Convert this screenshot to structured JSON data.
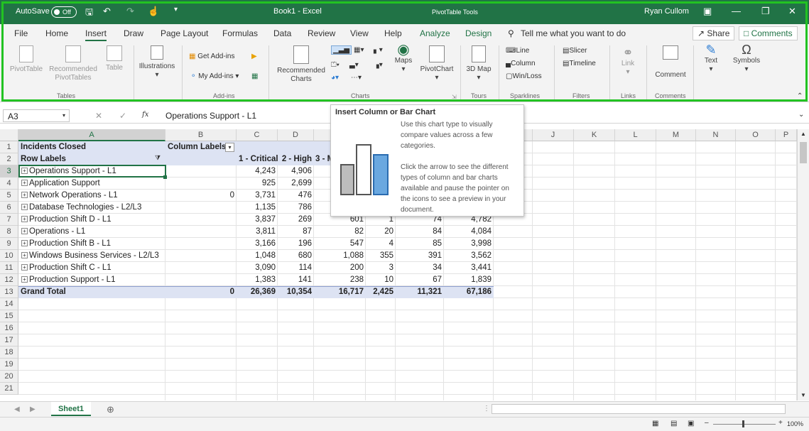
{
  "titlebar": {
    "autosave": "AutoSave",
    "toggle": "Off",
    "doc": "Book1 - Excel",
    "context": "PivotTable Tools",
    "user": "Ryan Cullom"
  },
  "tabs": [
    "File",
    "Home",
    "Insert",
    "Draw",
    "Page Layout",
    "Formulas",
    "Data",
    "Review",
    "View",
    "Help",
    "Analyze",
    "Design"
  ],
  "tellme": "Tell me what you want to do",
  "share": "Share",
  "comments": "Comments",
  "ribbon": {
    "pivottable": "PivotTable",
    "recommended_pt": "Recommended PivotTables",
    "table": "Table",
    "illustrations": "Illustrations",
    "get_addins": "Get Add-ins",
    "my_addins": "My Add-ins",
    "rec_charts": "Recommended Charts",
    "maps": "Maps",
    "pivotchart": "PivotChart",
    "map3d": "3D Map",
    "line": "Line",
    "column": "Column",
    "winloss": "Win/Loss",
    "slicer": "Slicer",
    "timeline": "Timeline",
    "link": "Link",
    "comment": "Comment",
    "text": "Text",
    "symbols": "Symbols",
    "groups": {
      "tables": "Tables",
      "addins": "Add-ins",
      "charts": "Charts",
      "tours": "Tours",
      "sparklines": "Sparklines",
      "filters": "Filters",
      "links": "Links",
      "comments": "Comments"
    }
  },
  "formula": {
    "namebox": "A3",
    "fx": "fx",
    "value": "Operations Support - L1"
  },
  "tooltip": {
    "title": "Insert Column or Bar Chart",
    "p1": "Use this chart type to visually compare values across a few categories.",
    "p2": "Click the arrow to see the different types of column and bar charts available and pause the pointer on the icons to see a preview in your document."
  },
  "columns": [
    "A",
    "B",
    "C",
    "D",
    "",
    "",
    "",
    "",
    "",
    "J",
    "K",
    "L",
    "M",
    "N",
    "O",
    "P"
  ],
  "pivot": {
    "a1": "Incidents Closed",
    "b1": "Column Labels",
    "a2": "Row Labels",
    "h2": [
      "1 - Critical",
      "2 - High",
      "3 - M"
    ],
    "rows": [
      [
        "Operations Support - L1",
        "",
        "4,243",
        "4,906",
        "",
        "",
        "",
        ""
      ],
      [
        "Application Support",
        "",
        "925",
        "2,699",
        "",
        "",
        "",
        ""
      ],
      [
        "Network Operations - L1",
        "0",
        "3,731",
        "476",
        "",
        "",
        "",
        ""
      ],
      [
        "Database Technologies - L2/L3",
        "",
        "1,135",
        "786",
        "",
        "",
        "",
        ""
      ],
      [
        "Production Shift D - L1",
        "",
        "3,837",
        "269",
        "601",
        "1",
        "74",
        "4,782"
      ],
      [
        "Operations - L1",
        "",
        "3,811",
        "87",
        "82",
        "20",
        "84",
        "4,084"
      ],
      [
        "Production Shift B - L1",
        "",
        "3,166",
        "196",
        "547",
        "4",
        "85",
        "3,998"
      ],
      [
        "Windows Business Services - L2/L3",
        "",
        "1,048",
        "680",
        "1,088",
        "355",
        "391",
        "3,562"
      ],
      [
        "Production Shift C - L1",
        "",
        "3,090",
        "114",
        "200",
        "3",
        "34",
        "3,441"
      ],
      [
        "Production Support - L1",
        "",
        "1,383",
        "141",
        "238",
        "10",
        "67",
        "1,839"
      ]
    ],
    "total": [
      "Grand Total",
      "0",
      "26,369",
      "10,354",
      "16,717",
      "2,425",
      "11,321",
      "67,186"
    ]
  },
  "rownums": [
    "1",
    "2",
    "3",
    "4",
    "5",
    "6",
    "7",
    "8",
    "9",
    "10",
    "11",
    "12",
    "13",
    "14",
    "15",
    "16",
    "17",
    "18",
    "19",
    "20",
    "21"
  ],
  "sheet": "Sheet1",
  "zoom": "100%"
}
